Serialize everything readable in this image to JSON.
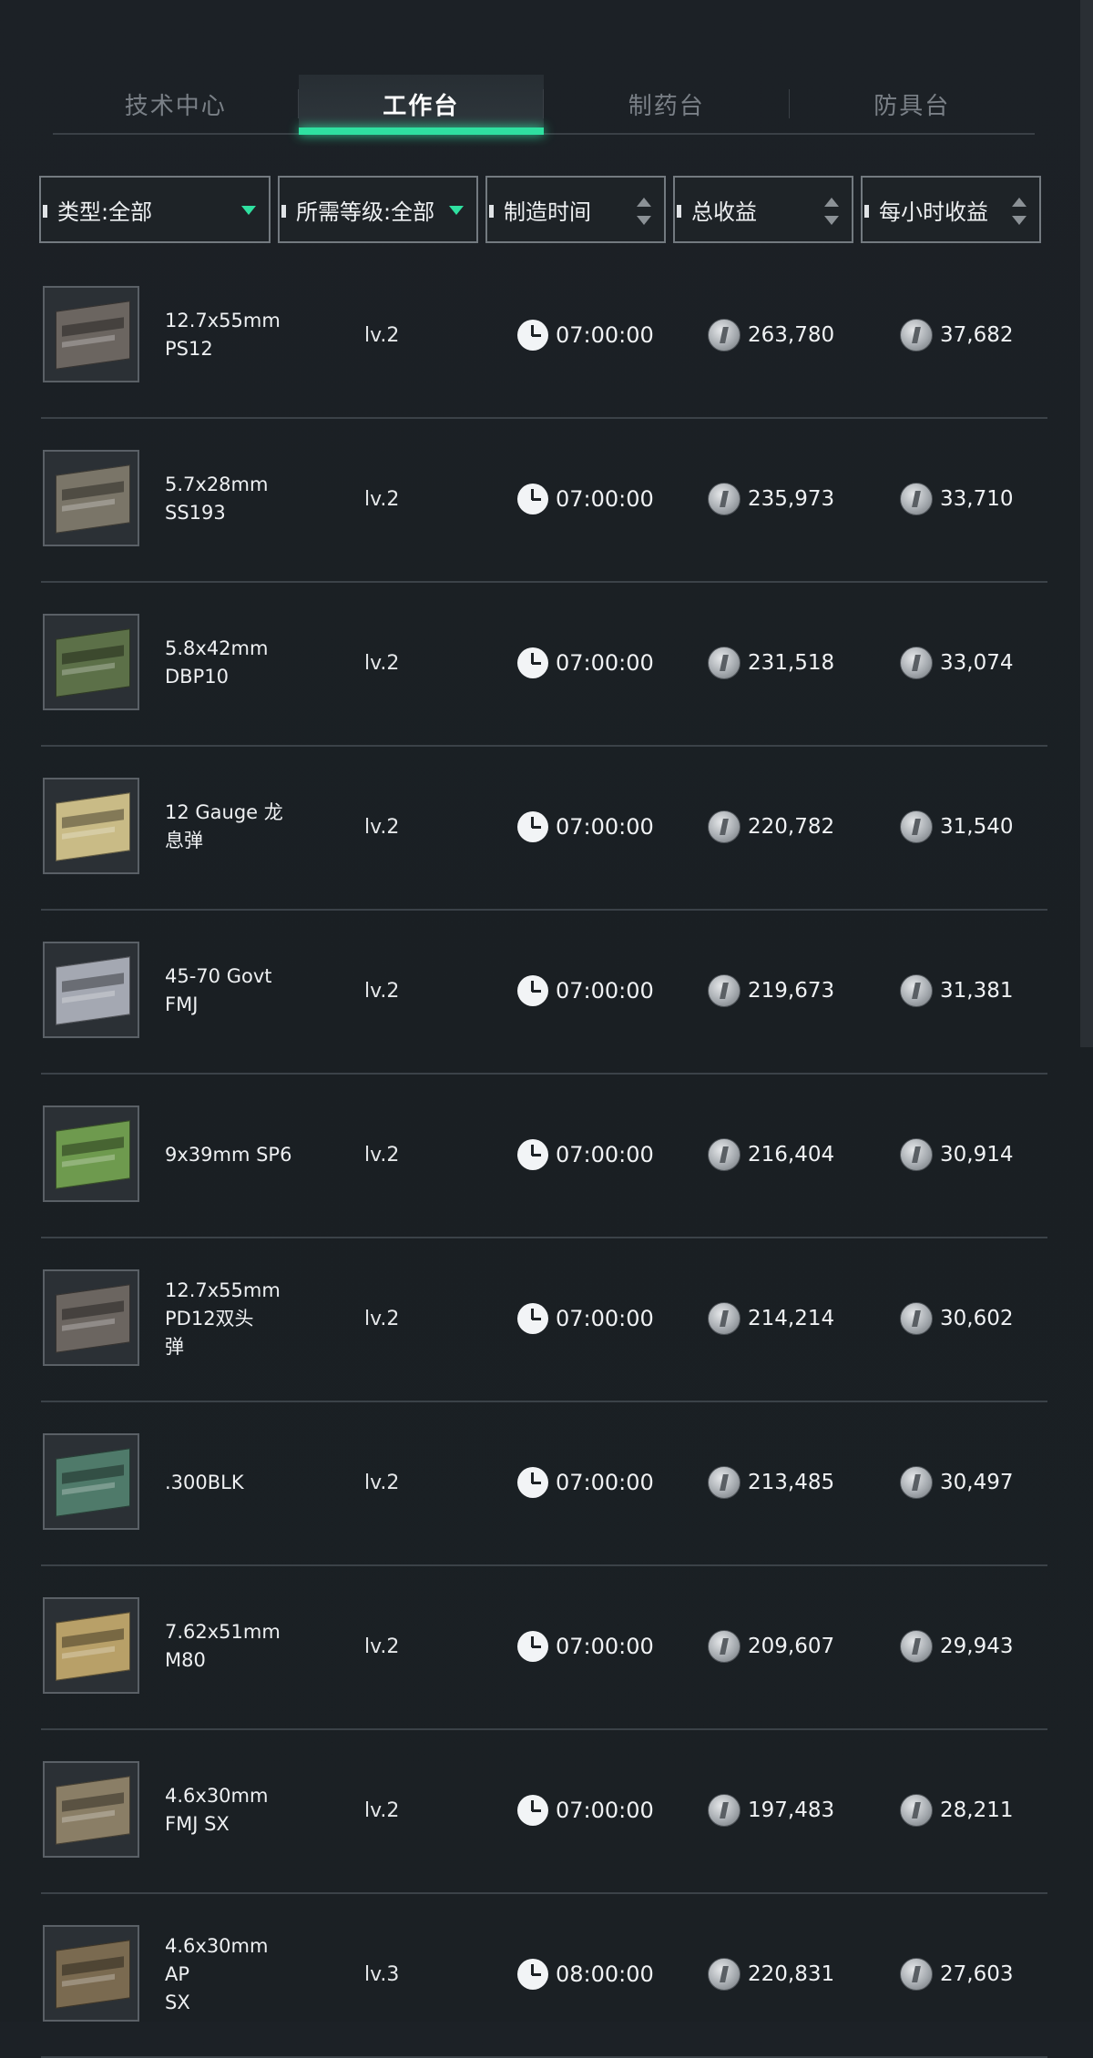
{
  "tabs": [
    "技术中心",
    "工作台",
    "制药台",
    "防具台"
  ],
  "active_tab": "工作台",
  "filters": {
    "type": "类型:全部",
    "level": "所需等级:全部",
    "time": "制造时间",
    "total": "总收益",
    "hourly": "每小时收益"
  },
  "colors": {
    "accent": "#2fe0a0",
    "background": "#1c2126"
  },
  "items": [
    {
      "name": "12.7x55mm\nPS12",
      "level": "lv.2",
      "time": "07:00:00",
      "total": "263,780",
      "hourly": "37,682",
      "box_color": "#6b6560"
    },
    {
      "name": "5.7x28mm\nSS193",
      "level": "lv.2",
      "time": "07:00:00",
      "total": "235,973",
      "hourly": "33,710",
      "box_color": "#7a7568"
    },
    {
      "name": "5.8x42mm\nDBP10",
      "level": "lv.2",
      "time": "07:00:00",
      "total": "231,518",
      "hourly": "33,074",
      "box_color": "#5c7048"
    },
    {
      "name": "12 Gauge 龙\n息弹",
      "level": "lv.2",
      "time": "07:00:00",
      "total": "220,782",
      "hourly": "31,540",
      "box_color": "#c9bb86"
    },
    {
      "name": "45-70 Govt\nFMJ",
      "level": "lv.2",
      "time": "07:00:00",
      "total": "219,673",
      "hourly": "31,381",
      "box_color": "#a4a8b2"
    },
    {
      "name": "9x39mm SP6",
      "level": "lv.2",
      "time": "07:00:00",
      "total": "216,404",
      "hourly": "30,914",
      "box_color": "#6e9a4e"
    },
    {
      "name": "12.7x55mm\nPD12双头\n弹",
      "level": "lv.2",
      "time": "07:00:00",
      "total": "214,214",
      "hourly": "30,602",
      "box_color": "#6b6560"
    },
    {
      "name": ".300BLK",
      "level": "lv.2",
      "time": "07:00:00",
      "total": "213,485",
      "hourly": "30,497",
      "box_color": "#4f7a6a"
    },
    {
      "name": "7.62x51mm\nM80",
      "level": "lv.2",
      "time": "07:00:00",
      "total": "209,607",
      "hourly": "29,943",
      "box_color": "#b8a068"
    },
    {
      "name": "4.6x30mm\nFMJ SX",
      "level": "lv.2",
      "time": "07:00:00",
      "total": "197,483",
      "hourly": "28,211",
      "box_color": "#8a7e66"
    },
    {
      "name": "4.6x30mm AP\nSX",
      "level": "lv.3",
      "time": "08:00:00",
      "total": "220,831",
      "hourly": "27,603",
      "box_color": "#7a6a50"
    }
  ]
}
